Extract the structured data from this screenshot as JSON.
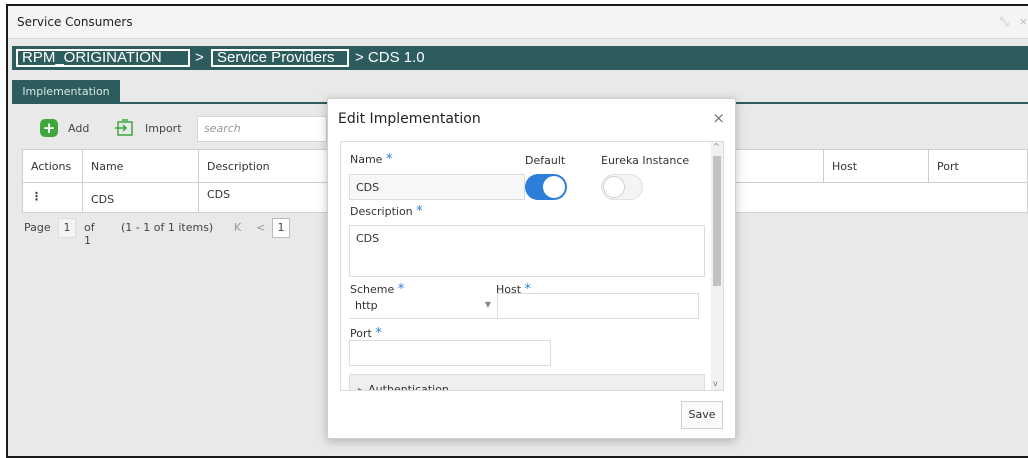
{
  "window": {
    "title": "Service Consumers"
  },
  "breadcrumb": {
    "root": "RPM_ORIGINATION",
    "sep": ">",
    "providers": "Service Providers",
    "current": "> CDS 1.0"
  },
  "tabs": [
    {
      "label": "Implementation"
    }
  ],
  "toolbar": {
    "add_label": "Add",
    "import_label": "Import",
    "search_placeholder": "search"
  },
  "grid": {
    "columns": [
      "Actions",
      "Name",
      "Description",
      "Host",
      "Port"
    ],
    "rows": [
      {
        "actions": "⋮",
        "name": "CDS",
        "description": "CDS"
      }
    ]
  },
  "pager": {
    "page_label": "Page",
    "page": "1",
    "of": "of 1",
    "range": "(1 - 1 of 1 items)",
    "first": "K",
    "prev": "<",
    "current": "1"
  },
  "modal": {
    "title": "Edit Implementation",
    "close": "×",
    "req_mark": "*",
    "name_label": "Name",
    "name_value": "CDS",
    "default_label": "Default",
    "default_on": true,
    "eureka_label": "Eureka Instance",
    "eureka_on": false,
    "description_label": "Description",
    "description_value": "CDS",
    "scheme_label": "Scheme",
    "scheme_value": "http",
    "host_label": "Host",
    "host_value": "",
    "port_label": "Port",
    "port_value": "",
    "auth_label": "Authentication",
    "save_label": "Save"
  }
}
